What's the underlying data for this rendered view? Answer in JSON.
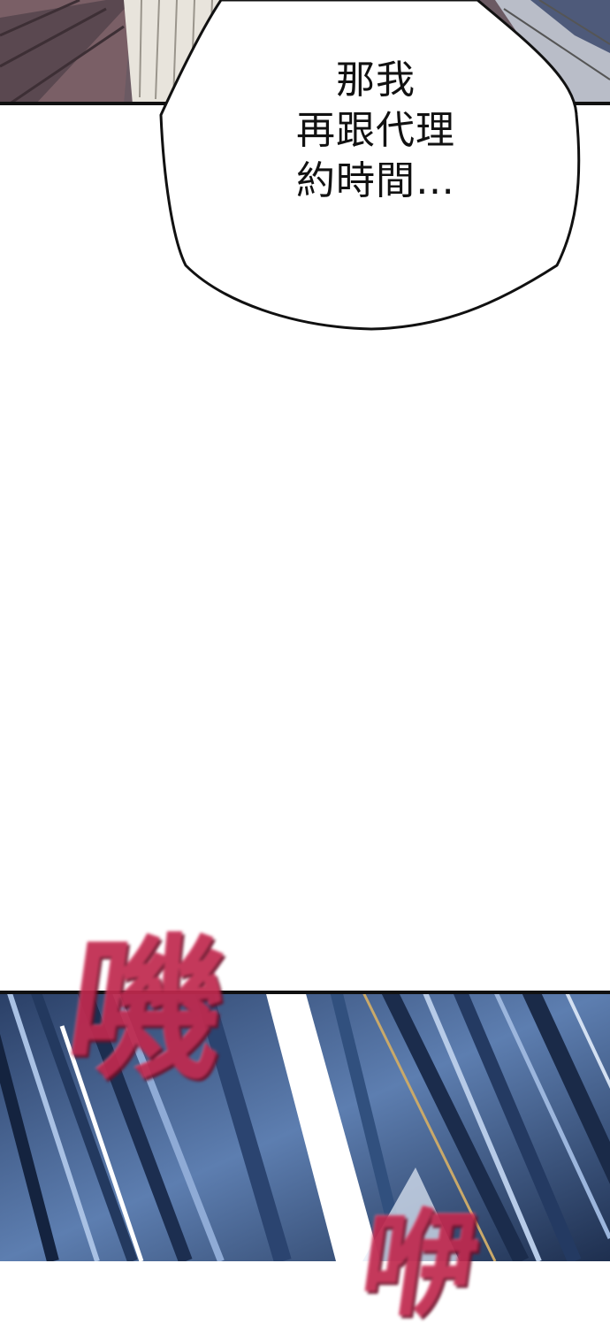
{
  "top_panel": {
    "bubble_lines": [
      "那我",
      "再跟代理",
      "約時間…"
    ]
  },
  "bottom_panel": {
    "sfx_1": "嘰",
    "sfx_2": "咿"
  },
  "colors": {
    "sfx": "#c0294e",
    "speed_lines_dark": "#1f3558",
    "speed_lines_light": "#9fb8dc",
    "border": "#111111"
  }
}
